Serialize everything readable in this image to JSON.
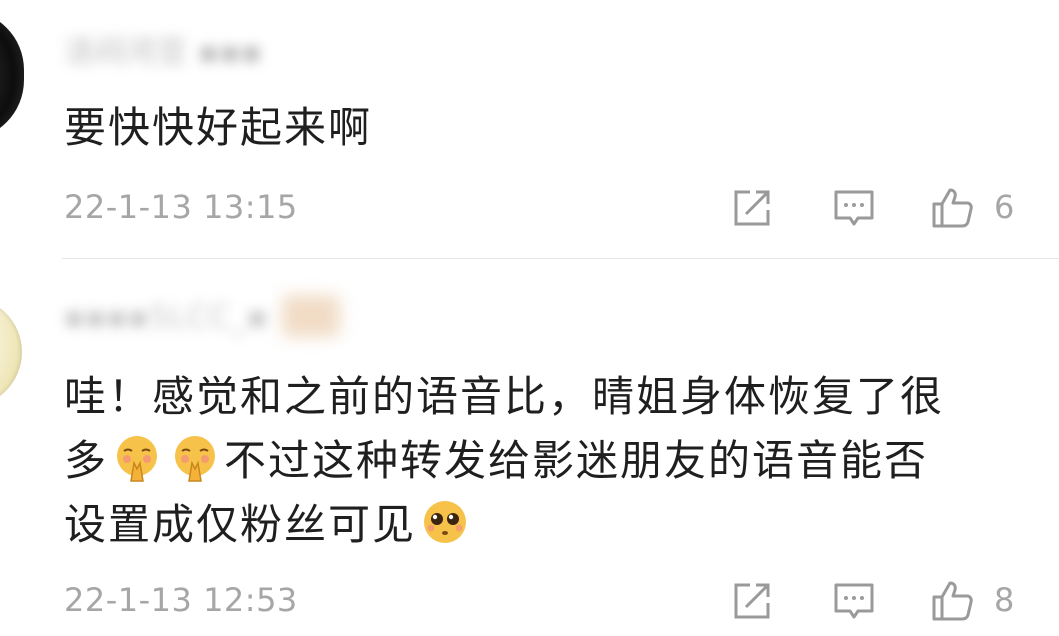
{
  "comments": [
    {
      "username": "活闷河豆 ▪▪▪",
      "text": "要快快好起来啊",
      "timestamp": "22-1-13 13:15",
      "likes": "6",
      "icons": {
        "share": "share-icon",
        "reply": "comment-icon",
        "like": "thumbs-up-icon"
      }
    },
    {
      "username": "▪▪▪▪5LCC_▪",
      "text_line1": "哇！感觉和之前的语音比，晴姐身体恢复了很",
      "text_line2_a": "多",
      "text_line2_b": "不过这种转发给影迷朋友的语音能否",
      "text_line3": "设置成仅粉丝可见",
      "timestamp": "22-1-13 12:53",
      "likes": "8",
      "emojis": [
        "praying-blush-emoji",
        "praying-blush-emoji",
        "pleading-face-emoji"
      ],
      "icons": {
        "share": "share-icon",
        "reply": "comment-icon",
        "like": "thumbs-up-icon"
      }
    }
  ],
  "colors": {
    "text": "#1f1f1f",
    "meta": "#a6a6a6",
    "icon": "#9a9a9a",
    "divider": "#e6e6e6",
    "emoji": "#f7c24a"
  }
}
